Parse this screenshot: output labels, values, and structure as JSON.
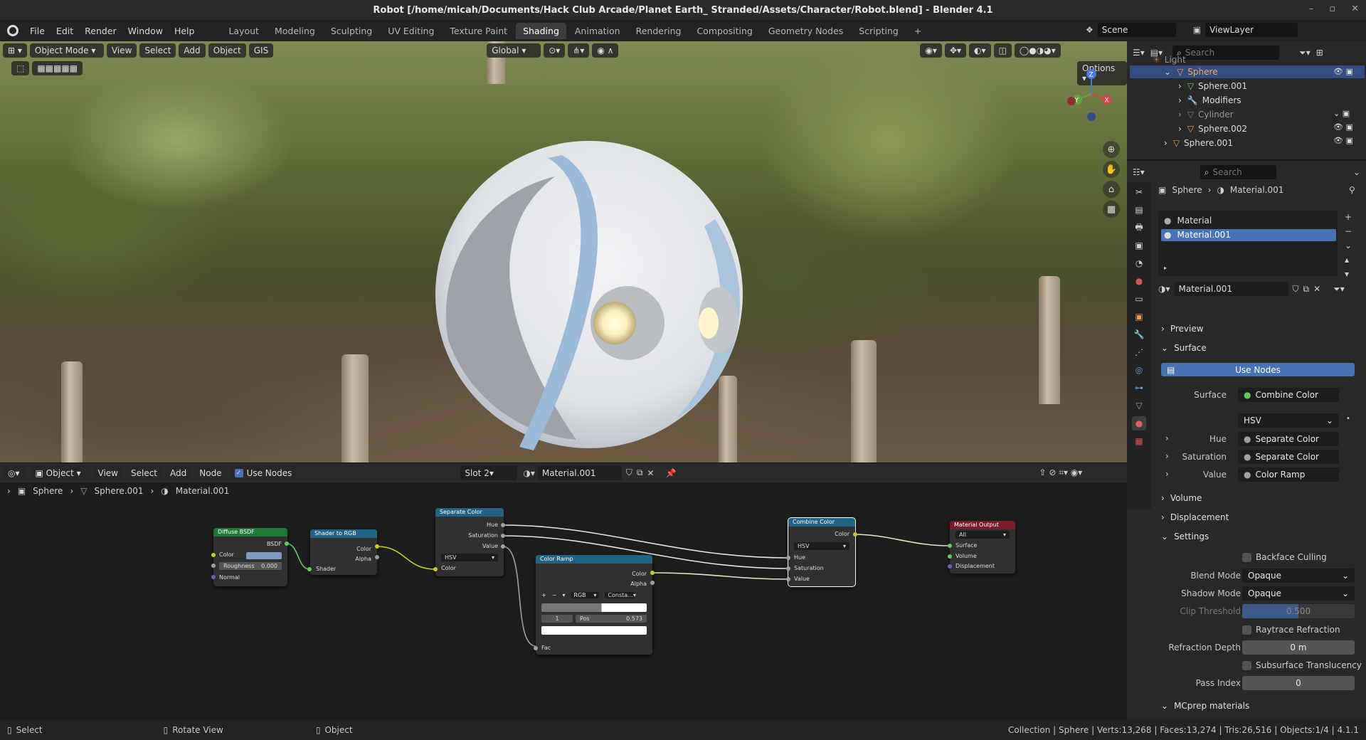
{
  "titlebar": {
    "title": "Robot [/home/micah/Documents/Hack Club Arcade/Planet Earth_ Stranded/Assets/Character/Robot.blend] - Blender 4.1"
  },
  "menu": [
    "File",
    "Edit",
    "Render",
    "Window",
    "Help"
  ],
  "workspaces": [
    "Layout",
    "Modeling",
    "Sculpting",
    "UV Editing",
    "Texture Paint",
    "Shading",
    "Animation",
    "Rendering",
    "Compositing",
    "Geometry Nodes",
    "Scripting"
  ],
  "active_workspace": "Shading",
  "scene": {
    "label": "Scene",
    "viewlayer": "ViewLayer"
  },
  "viewport": {
    "mode": "Object Mode",
    "menus": [
      "View",
      "Select",
      "Add",
      "Object",
      "GIS"
    ],
    "orientation": "Global",
    "options": "Options",
    "axes": {
      "z": "Z",
      "y": "Y",
      "x": "X"
    }
  },
  "outliner": {
    "search_placeholder": "Search",
    "items": [
      {
        "label": "Light"
      },
      {
        "label": "Sphere"
      },
      {
        "label": "Sphere.001"
      },
      {
        "label": "Modifiers"
      },
      {
        "label": "Cylinder"
      },
      {
        "label": "Sphere.002"
      },
      {
        "label": "Sphere.001"
      }
    ]
  },
  "node_editor": {
    "object_mode": "Object",
    "menus": [
      "View",
      "Select",
      "Add",
      "Node"
    ],
    "use_nodes": "Use Nodes",
    "slot": "Slot 2",
    "material": "Material.001",
    "breadcrumb": [
      "Sphere",
      "Sphere.001",
      "Material.001"
    ],
    "nodes": {
      "diffuse": {
        "title": "Diffuse BSDF",
        "out": "BSDF",
        "color": "Color",
        "roughness": "Roughness",
        "roughness_val": "0.000",
        "normal": "Normal"
      },
      "shader_rgb": {
        "title": "Shader to RGB",
        "color": "Color",
        "alpha": "Alpha",
        "shader": "Shader"
      },
      "separate": {
        "title": "Separate Color",
        "hue": "Hue",
        "sat": "Saturation",
        "val": "Value",
        "mode": "HSV",
        "color": "Color"
      },
      "ramp": {
        "title": "Color Ramp",
        "color": "Color",
        "alpha": "Alpha",
        "mode": "RGB",
        "interp": "Consta...",
        "index": "1",
        "pos_label": "Pos",
        "pos_val": "0.573",
        "fac": "Fac"
      },
      "combine": {
        "title": "Combine Color",
        "color": "Color",
        "mode": "HSV",
        "hue": "Hue",
        "sat": "Saturation",
        "val": "Value"
      },
      "output": {
        "title": "Material Output",
        "target": "All",
        "surface": "Surface",
        "volume": "Volume",
        "disp": "Displacement"
      }
    }
  },
  "properties": {
    "search_placeholder": "Search",
    "crumb_object": "Sphere",
    "crumb_material": "Material.001",
    "slots": [
      "Material",
      "Material.001"
    ],
    "material_name": "Material.001",
    "sections": {
      "preview": "Preview",
      "surface": "Surface",
      "volume": "Volume",
      "displacement": "Displacement",
      "settings": "Settings",
      "mcprep": "MCprep materials"
    },
    "use_nodes": "Use Nodes",
    "surface": {
      "surface_label": "Surface",
      "surface_val": "Combine Color",
      "mode": "HSV",
      "hue_label": "Hue",
      "hue_val": "Separate Color",
      "sat_label": "Saturation",
      "sat_val": "Separate Color",
      "val_label": "Value",
      "val_val": "Color Ramp"
    },
    "settings": {
      "backface": "Backface Culling",
      "blend_label": "Blend Mode",
      "blend_val": "Opaque",
      "shadow_label": "Shadow Mode",
      "shadow_val": "Opaque",
      "clip_label": "Clip Threshold",
      "clip_val": "0.500",
      "raytrace": "Raytrace Refraction",
      "depth_label": "Refraction Depth",
      "depth_val": "0 m",
      "sss": "Subsurface Translucency",
      "pass_label": "Pass Index",
      "pass_val": "0"
    }
  },
  "status": {
    "select": "Select",
    "rotate": "Rotate View",
    "object": "Object",
    "stats": "Collection | Sphere | Verts:13,268 | Faces:13,274 | Tris:26,516 | Objects:1/4 | 4.1.1"
  },
  "colors": {
    "accent": "#4772b3",
    "node_shader": "#1d7a37",
    "node_converter": "#246283",
    "node_output": "#7a1d2b"
  }
}
